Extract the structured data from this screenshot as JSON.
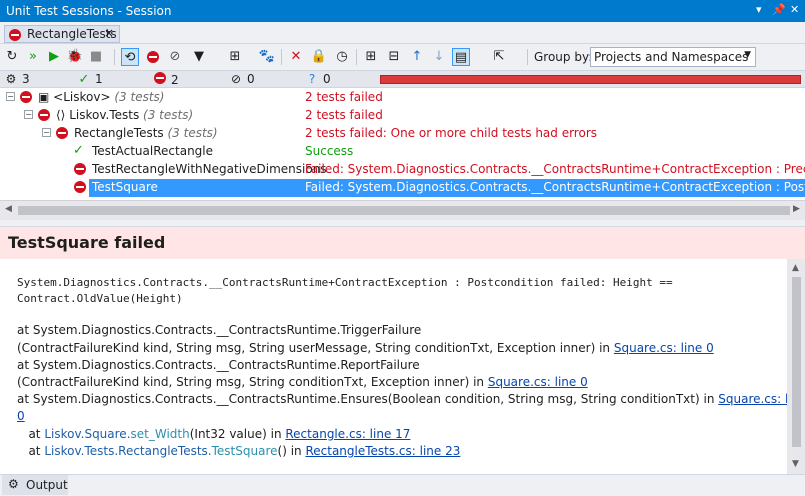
{
  "window": {
    "title": "Unit Test Sessions - Session"
  },
  "tab": {
    "label": "RectangleTests",
    "close": "×"
  },
  "toolbar": {
    "group_by_label": "Group by:",
    "group_by_value": "Projects and Namespaces"
  },
  "stats": {
    "total": "3",
    "passed": "1",
    "failed": "2",
    "ignored": "0",
    "unknown": "0"
  },
  "progress": {
    "failed_fraction": 1.0,
    "color": "#d93b3b"
  },
  "tree": {
    "rows": [
      {
        "name": "<Liskov>",
        "count": "(3 tests)",
        "result": "2 tests failed"
      },
      {
        "name": "Liskov.Tests",
        "count": "(3 tests)",
        "result": "2 tests failed"
      },
      {
        "name": "RectangleTests",
        "count": "(3 tests)",
        "result": "2 tests failed: One or more child tests had errors"
      },
      {
        "name": "TestActualRectangle",
        "result": "Success"
      },
      {
        "name": "TestRectangleWithNegativeDimensions",
        "result": "Failed: System.Diagnostics.Contracts.__ContractsRuntime+ContractException : Precondition failed"
      },
      {
        "name": "TestSquare",
        "result": "Failed: System.Diagnostics.Contracts.__ContractsRuntime+ContractException : Postcondition failed"
      }
    ]
  },
  "detail": {
    "title": "TestSquare failed",
    "message": "System.Diagnostics.Contracts.__ContractsRuntime+ContractException : Postcondition failed: Height == Contract.OldValue(Height)",
    "stack": [
      {
        "text": "   at System.Diagnostics.Contracts.__ContractsRuntime.TriggerFailure"
      },
      {
        "text": "(ContractFailureKind kind, String msg, String userMessage, String conditionTxt, Exception inner) in ",
        "link": "Square.cs: line 0"
      },
      {
        "text": "   at System.Diagnostics.Contracts.__ContractsRuntime.ReportFailure"
      },
      {
        "text": "(ContractFailureKind kind, String msg, String conditionTxt, Exception inner) in ",
        "link": "Square.cs: line 0"
      },
      {
        "text": "   at System.Diagnostics.Contracts.__ContractsRuntime.Ensures(Boolean condition, String msg, String conditionTxt) in ",
        "link": "Square.cs: line"
      },
      {
        "text": "",
        "link": "0"
      }
    ],
    "frame1": {
      "at": "   at ",
      "type": "Liskov.Square.",
      "method": "set_Width",
      "args": "(Int32 value) in ",
      "link": "Rectangle.cs: line 17"
    },
    "frame2": {
      "at": "   at ",
      "type": "Liskov.Tests.RectangleTests.",
      "method": "TestSquare",
      "args": "() in ",
      "link": "RectangleTests.cs: line 23"
    }
  },
  "bottom": {
    "tab_label": "Output"
  }
}
